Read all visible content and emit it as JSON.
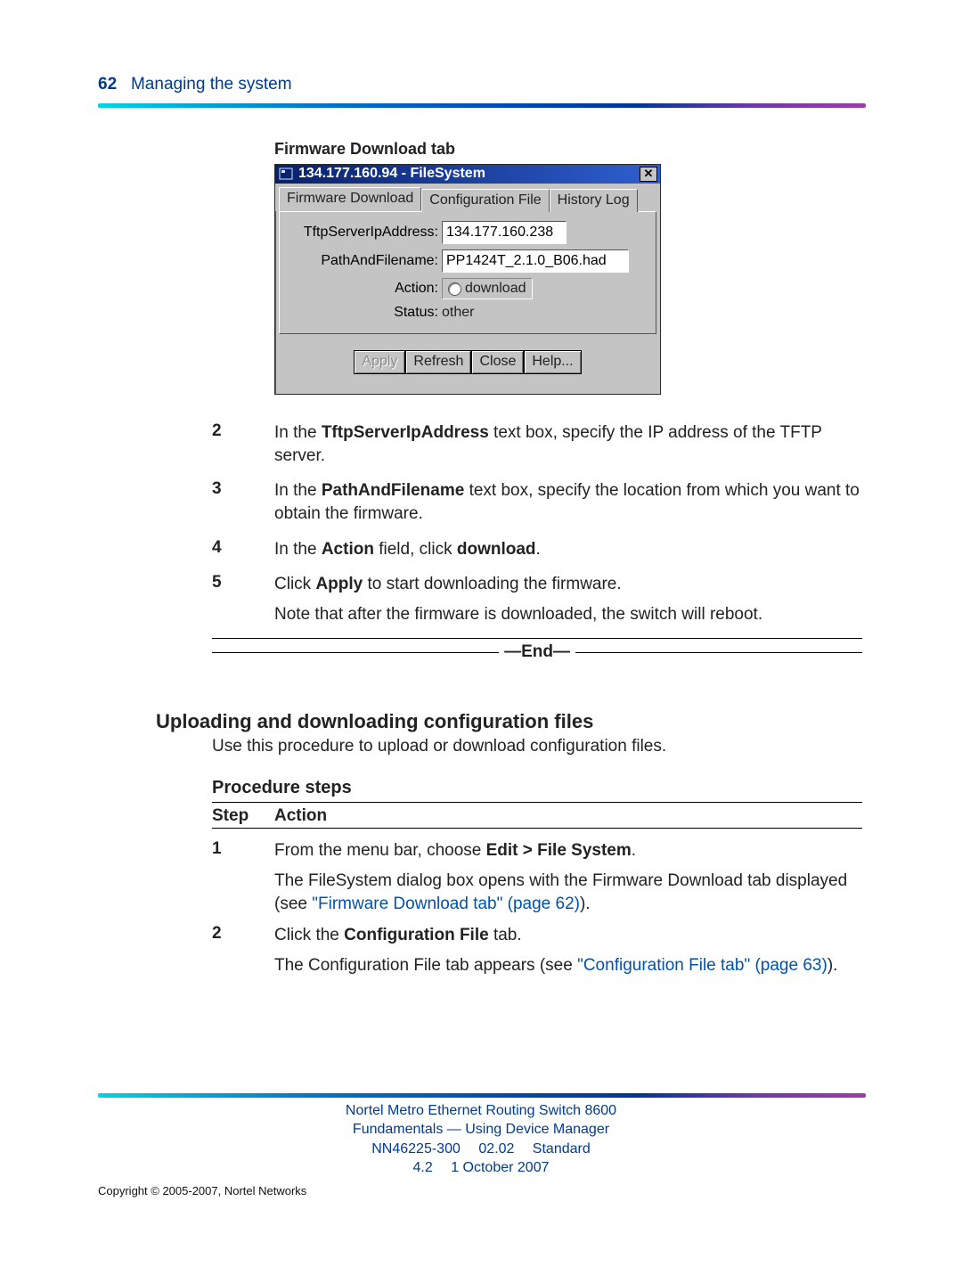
{
  "header": {
    "page_number": "62",
    "chapter": "Managing the system"
  },
  "figure": {
    "caption": "Firmware Download tab",
    "dialog": {
      "title": "134.177.160.94 - FileSystem",
      "tabs": [
        "Firmware Download",
        "Configuration File",
        "History Log"
      ],
      "fields": {
        "tftp_label": "TftpServerIpAddress:",
        "tftp_value": "134.177.160.238",
        "path_label": "PathAndFilename:",
        "path_value": "PP1424T_2.1.0_B06.had",
        "action_label": "Action:",
        "action_value": "download",
        "status_label": "Status:",
        "status_value": "other"
      },
      "buttons": {
        "apply": "Apply",
        "refresh": "Refresh",
        "close": "Close",
        "help": "Help..."
      }
    }
  },
  "steps_a": [
    {
      "n": "2",
      "pre": "In the ",
      "bold": "TftpServerIpAddress",
      "post": " text box, specify the IP address of the TFTP server."
    },
    {
      "n": "3",
      "pre": "In the ",
      "bold": "PathAndFilename",
      "post": " text box, specify the location from which you want to obtain the firmware."
    },
    {
      "n": "4",
      "pre": "In the ",
      "bold": "Action",
      "mid": " field, click ",
      "bold2": "download",
      "post2": "."
    },
    {
      "n": "5",
      "pre": "Click ",
      "bold": "Apply",
      "post": " to start downloading the firmware.",
      "note": "Note that after the firmware is downloaded, the switch will reboot."
    }
  ],
  "end_marker": "—End—",
  "section": {
    "title": "Uploading and downloading configuration files",
    "intro": "Use this procedure to upload or download configuration files.",
    "proc_heading": "Procedure steps",
    "col_step": "Step",
    "col_action": "Action"
  },
  "steps_b": [
    {
      "n": "1",
      "pre": "From the menu bar, choose ",
      "bold": "Edit > File System",
      "post": ".",
      "sub": "The FileSystem dialog box opens with the Firmware Download tab displayed (see ",
      "link": "\"Firmware Download tab\" (page 62)",
      "sub_post": ")."
    },
    {
      "n": "2",
      "pre": "Click the ",
      "bold": "Configuration File",
      "post": " tab.",
      "sub": "The Configuration File tab appears (see ",
      "link": "\"Configuration File tab\" (page 63)",
      "sub_post": ")."
    }
  ],
  "footer": {
    "line1": "Nortel Metro Ethernet Routing Switch 8600",
    "line2": "Fundamentals — Using Device Manager",
    "line3": "NN46225-300  02.02  Standard",
    "line4": "4.2  1 October 2007",
    "copyright": "Copyright © 2005-2007, Nortel Networks"
  }
}
